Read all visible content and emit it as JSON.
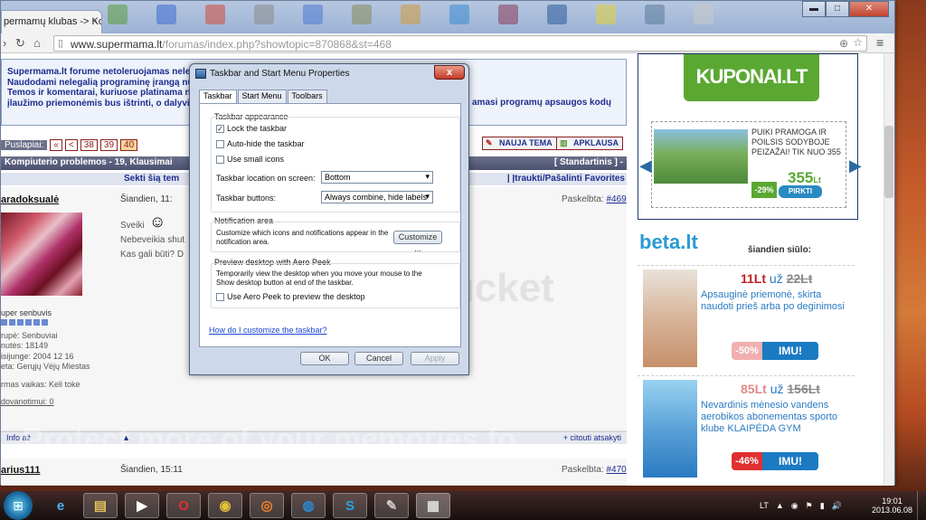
{
  "browser": {
    "tab_title": "permamų klubas -> Ko",
    "tab_close": "×",
    "url_scheme": "www.supermama.lt",
    "url_path": "/forumas/index.php?showtopic=870868&st=468",
    "controls": {
      "minimize": "▬",
      "maximize": "□",
      "close": "✕"
    }
  },
  "forum": {
    "notice_lines": [
      "Supermama.lt forume netoleruojamas nele",
      "Naudodami nelegalią programinę įrangą nu",
      "Temos ir komentarai, kuriuose platinama ne",
      "įlaužimo priemonėmis bus ištrinti, o dalyvi"
    ],
    "notice_right_1": "amasi programų apsaugos kodų",
    "pager": {
      "label": "Puslapiai:",
      "prev_first": "«",
      "prev": "<",
      "pages": [
        "38",
        "39",
        "40"
      ],
      "current": "40"
    },
    "new_topic": "NAUJA TEMA",
    "poll": "APKLAUSA",
    "topic_title": "Kompiuterio problemos - 19, Klausimai",
    "view_mode": "[ Standartinis ] -",
    "sub_left": "Sekti šią tem",
    "sub_right": "| Įtraukti/Pašalinti Favorites",
    "post1": {
      "author": "aradoksualė",
      "date": "Šiandien, 11:",
      "ref_label": "Paskelbta:",
      "ref_num": "#469",
      "text1": "Sveiki",
      "text2": "Nebeveikia shut",
      "text3": "Kas gali būti? D",
      "rank": "uper senbuvis",
      "info": [
        "rupė: Senbuviai",
        "nutės: 18149",
        "isijunge: 2004 12 16",
        "eta: Gerųjų Vėjų Miestas",
        "",
        "rmas vaikas: Keli toke",
        "",
        "dovanotimui: 0"
      ],
      "foot_left": "Info    až",
      "foot_right": "+ citouti   atsakyti"
    },
    "post2": {
      "author": "arius111",
      "date": "Šiandien, 15:11",
      "ref_label": "Paskelbta:",
      "ref_num": "#470"
    },
    "watermark_center": "bucket",
    "watermark_bottom": "Protect more of your memories fo"
  },
  "ads": {
    "kuponai_logo": "KUPONAI.LT",
    "kuponai_text": [
      "PUIKI PRAMOGA IR",
      "POILSIS SODYBOJE",
      "PEIZAŽAI! TIK NUO 355"
    ],
    "kuponai_price": "355",
    "kuponai_price_unit": "Lt",
    "kuponai_discount": "-29%",
    "kuponai_buy": "PIRKTI",
    "beta_logo": "beta.lt",
    "beta_tagline": "šiandien siūlo:",
    "deals": [
      {
        "price_new": "11Lt",
        "word": "už",
        "price_old": "22Lt",
        "desc": "Apsauginė priemonė, skirta naudoti prieš arba po deginimosi",
        "discount": "-50%",
        "button": "IMU!",
        "accent": "#f0b0b0"
      },
      {
        "price_new": "85Lt",
        "word": "už",
        "price_old": "156Lt",
        "desc": "Nevardinis mėnesio vandens aerobikos abonementas sporto klube KLAIPĖDA GYM",
        "discount": "-46%",
        "button": "IMU!",
        "accent": "#e03030"
      }
    ]
  },
  "dialog": {
    "title": "Taskbar and Start Menu Properties",
    "tabs": [
      "Taskbar",
      "Start Menu",
      "Toolbars"
    ],
    "appearance_label": "Taskbar appearance",
    "lock": "Lock the taskbar",
    "autohide": "Auto-hide the taskbar",
    "small_icons": "Use small icons",
    "location_label": "Taskbar location on screen:",
    "location_value": "Bottom",
    "buttons_label": "Taskbar buttons:",
    "buttons_value": "Always combine, hide labels",
    "notify_label": "Notification area",
    "notify_text": "Customize which icons and notifications appear in the notification area.",
    "customize": "Customize ...",
    "peek_label": "Preview desktop with Aero Peek",
    "peek_text": "Temporarily view the desktop when you move your mouse to the Show desktop button at end of the taskbar.",
    "peek_checkbox": "Use Aero Peek to preview the desktop",
    "help_link": "How do I customize the taskbar?",
    "ok": "OK",
    "cancel": "Cancel",
    "apply": "Apply",
    "close": "x"
  },
  "taskbar": {
    "lang": "LT",
    "time": "19:01",
    "date": "2013.06.08",
    "tray_icons": [
      "▲",
      "◉",
      "⚑",
      "▮",
      "🔊"
    ]
  }
}
